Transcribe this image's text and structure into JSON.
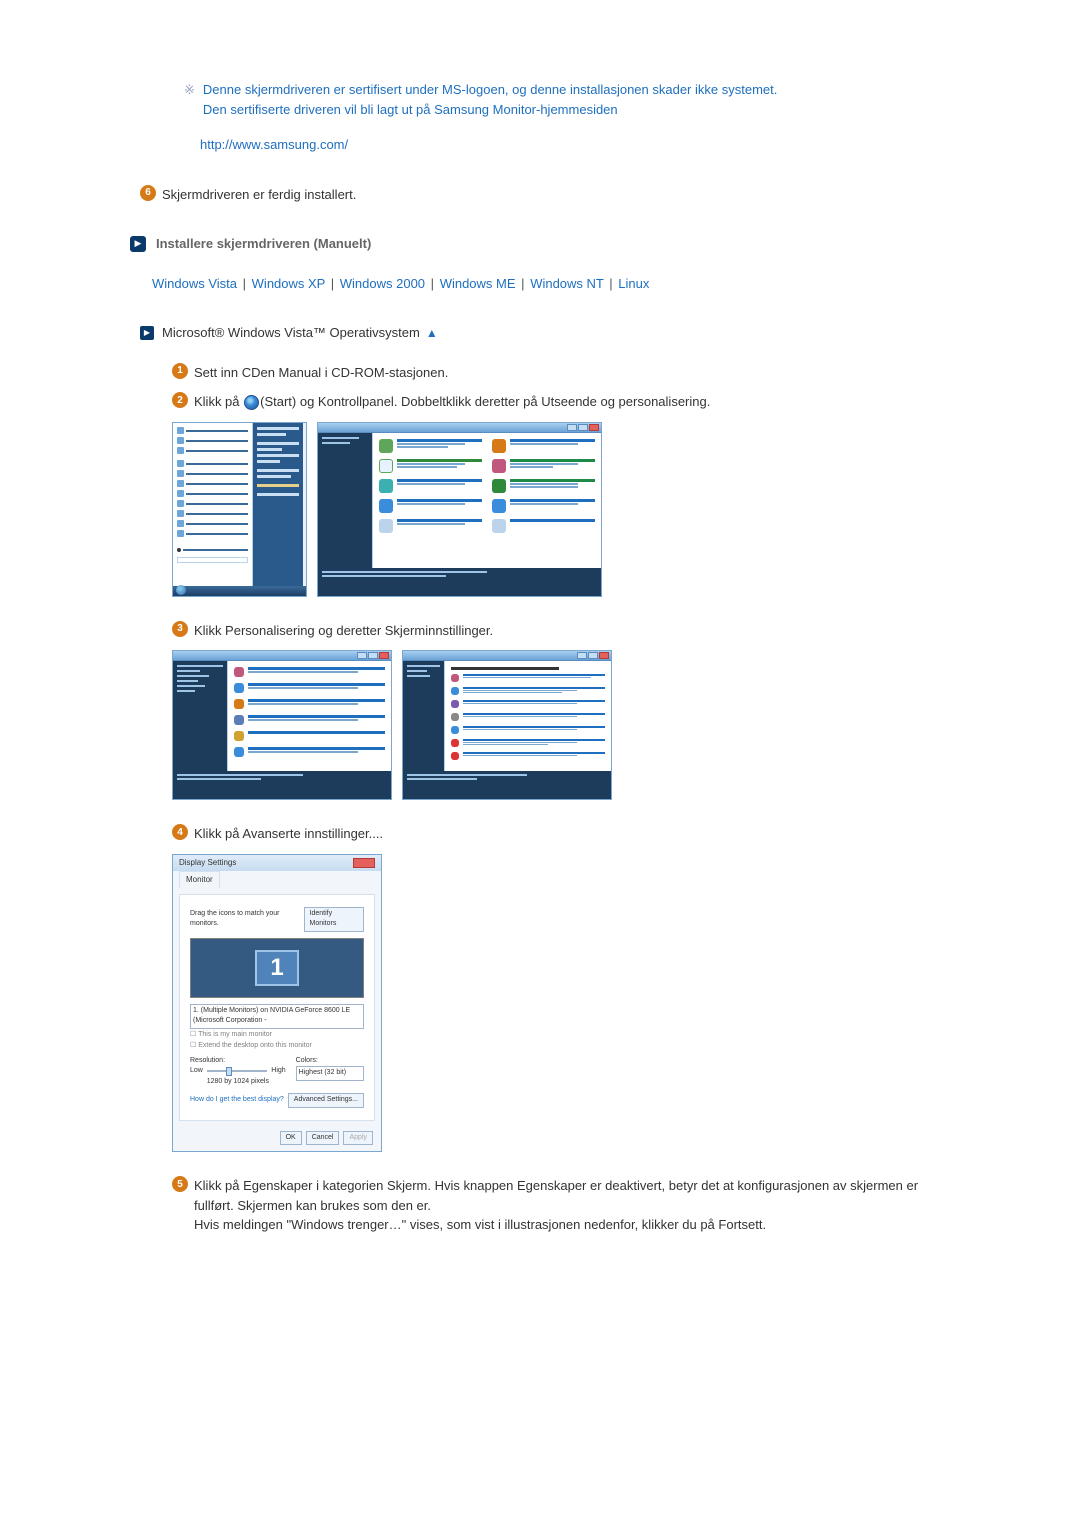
{
  "note": {
    "line1": "Denne skjermdriveren er sertifisert under MS-logoen, og denne installasjonen skader ikke systemet.",
    "line2": "Den sertifiserte driveren vil bli lagt ut på Samsung Monitor-hjemmesiden",
    "url": "http://www.samsung.com/"
  },
  "step6": "Skjermdriveren er ferdig installert.",
  "manual_header": "Installere skjermdriveren (Manuelt)",
  "os_links": [
    "Windows Vista",
    "Windows XP",
    "Windows 2000",
    "Windows ME",
    "Windows NT",
    "Linux"
  ],
  "vista_title": "Microsoft® Windows Vista™ Operativsystem",
  "vista_steps": {
    "s1": "Sett inn CDen Manual i CD-ROM-stasjonen.",
    "s2a": "Klikk på ",
    "s2b": "(Start) og Kontrollpanel. Dobbeltklikk deretter på Utseende og personalisering.",
    "s3": "Klikk Personalisering og deretter Skjerminnstillinger.",
    "s4": "Klikk på Avanserte innstillinger....",
    "s5": "Klikk på Egenskaper i kategorien Skjerm. Hvis knappen Egenskaper er deaktivert, betyr det at konfigurasjonen av skjermen er fullført. Skjermen kan brukes som den er.\nHvis meldingen \"Windows trenger…\" vises, som vist i illustrasjonen nedenfor, klikker du på Fortsett."
  },
  "display_dialog": {
    "title": "Display Settings",
    "tab": "Monitor",
    "drag_text": "Drag the icons to match your monitors.",
    "identify_btn": "Identify Monitors",
    "monitor_num": "1",
    "monitor_select": "1. (Multiple Monitors) on NVIDIA GeForce 8600 LE (Microsoft Corporation -",
    "chk1": "This is my main monitor",
    "chk2": "Extend the desktop onto this monitor",
    "resolution_label": "Resolution:",
    "low": "Low",
    "high": "High",
    "res_value": "1280 by 1024 pixels",
    "colors_label": "Colors:",
    "colors_value": "Highest (32 bit)",
    "help_link": "How do I get the best display?",
    "advanced_btn": "Advanced Settings...",
    "ok": "OK",
    "cancel": "Cancel",
    "apply": "Apply"
  }
}
